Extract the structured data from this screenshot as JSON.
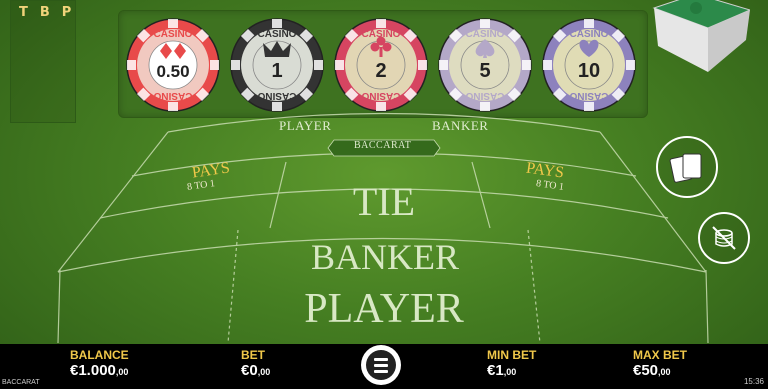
{
  "scoreboard": {
    "letters": [
      "T",
      "B",
      "P"
    ]
  },
  "chips": [
    {
      "brand": "CASINO",
      "value": "0.50",
      "color": "#f1c9c0",
      "ring": "#e84a4a",
      "suit": "diamonds"
    },
    {
      "brand": "CASINO",
      "value": "1",
      "color": "#d9dcd4",
      "ring": "#333333",
      "suit": "crown"
    },
    {
      "brand": "CASINO",
      "value": "2",
      "color": "#e2d6b4",
      "ring": "#d64561",
      "suit": "clubs"
    },
    {
      "brand": "CASINO",
      "value": "5",
      "color": "#dedcc0",
      "ring": "#b4a8c8",
      "suit": "spades"
    },
    {
      "brand": "CASINO",
      "value": "10",
      "color": "#e0dcb5",
      "ring": "#8d82bd",
      "suit": "hearts"
    }
  ],
  "table": {
    "player_label": "PLAYER",
    "banker_label": "BANKER",
    "game_label": "BACCARAT",
    "pays_left": "PAYS",
    "pays_left_odds": "8 TO 1",
    "pays_right": "PAYS",
    "pays_right_odds": "8 TO 1",
    "tie": "TIE",
    "banker": "BANKER",
    "player": "PLAYER"
  },
  "bottom": {
    "balance_label": "BALANCE",
    "balance_value": "€1.000",
    "balance_cents": ",00",
    "bet_label": "BET",
    "bet_value": "€0",
    "bet_cents": ",00",
    "min_bet_label": "MIN BET",
    "min_bet_value": "€1",
    "min_bet_cents": ",00",
    "max_bet_label": "MAX BET",
    "max_bet_value": "€50",
    "max_bet_cents": ",00"
  },
  "footer": {
    "game_name": "BACCARAT",
    "time": "15:36"
  },
  "colors": {
    "felt": "#467f22",
    "gold": "#f0c84a",
    "lines": "#c8dcb0"
  }
}
